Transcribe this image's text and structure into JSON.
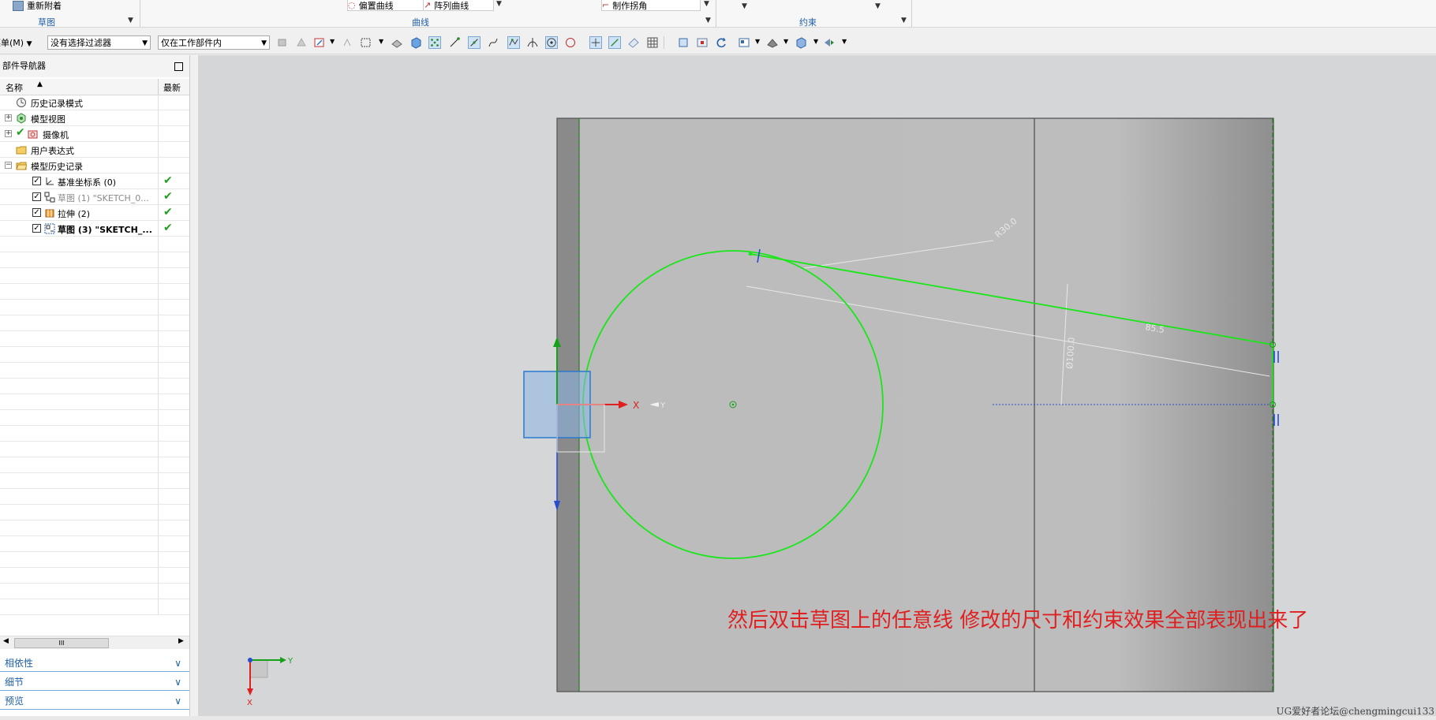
{
  "ribbon": {
    "reattach_label": "重新附着",
    "groups": {
      "sketch": "草图",
      "curve": "曲线",
      "constraint": "约束"
    },
    "offset_curve_label": "偏置曲线",
    "pattern_curve_label": "阵列曲线",
    "make_corner_label": "制作拐角"
  },
  "toolbar": {
    "menu_label": "菜单(M)",
    "selection_filter": "没有选择过滤器",
    "scope": "仅在工作部件内"
  },
  "navigator": {
    "title": "部件导航器",
    "col_name": "名称",
    "col_latest": "最新",
    "items": [
      {
        "label": "历史记录模式"
      },
      {
        "label": "模型视图"
      },
      {
        "label": "摄像机"
      },
      {
        "label": "用户表达式"
      },
      {
        "label": "模型历史记录"
      },
      {
        "label": "基准坐标系 (0)"
      },
      {
        "label": "草图 (1) \"SKETCH_0..."
      },
      {
        "label": "拉伸 (2)"
      },
      {
        "label": "草图 (3) \"SKETCH_..."
      }
    ],
    "scroll_label": "III",
    "panels": [
      "相依性",
      "细节",
      "预览"
    ]
  },
  "viewport": {
    "annotation": "然后双击草图上的任意线   修改的尺寸和约束效果全部表现出来了",
    "axis_x": "X",
    "axis_y": "Y",
    "triad_x": "X",
    "triad_y": "Y",
    "dim_radius": "R30.0",
    "dim_diameter": "Ø100.0",
    "dim_length": "85.5",
    "watermark": "UG爱好者论坛@chengmingcui133"
  },
  "colors": {
    "sketch_green": "#19e619",
    "accent_blue": "#1f5fa8",
    "annotation_red": "#e02020",
    "viewport_bg": "#d5d6d8"
  }
}
